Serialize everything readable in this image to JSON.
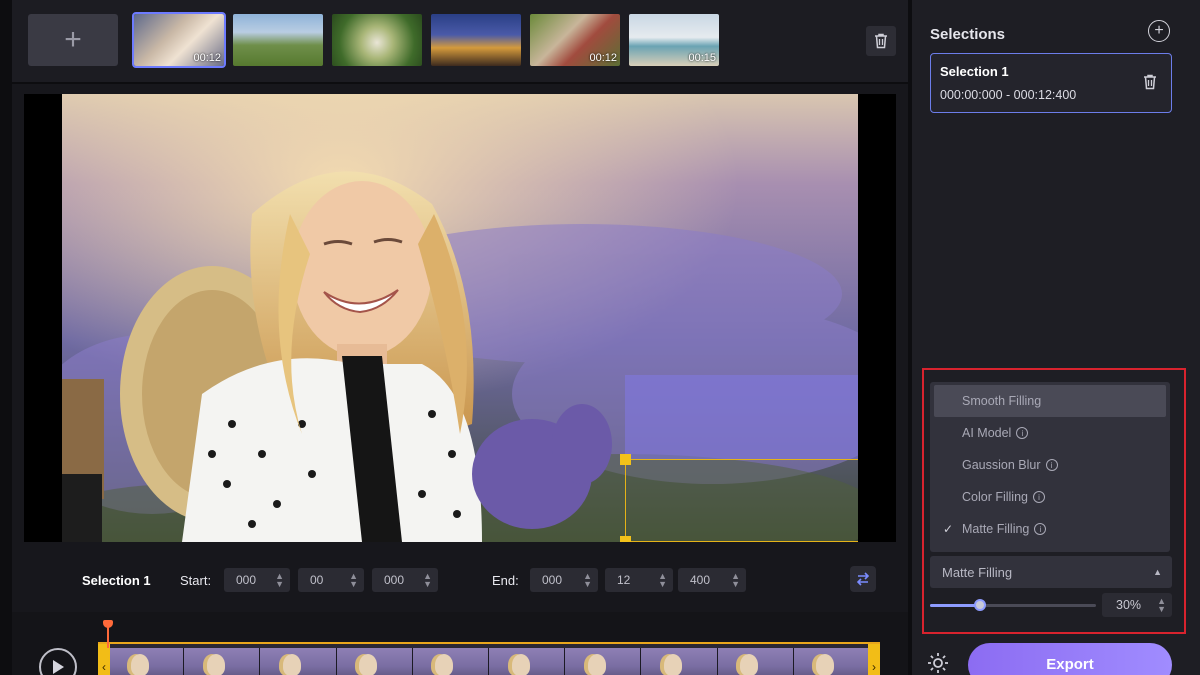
{
  "topbar": {
    "add_label": "+",
    "thumbnails": [
      {
        "duration": "00:12",
        "active": true
      },
      {
        "duration": "",
        "active": false
      },
      {
        "duration": "",
        "active": false
      },
      {
        "duration": "",
        "active": false
      },
      {
        "duration": "00:12",
        "active": false
      },
      {
        "duration": "00:15",
        "active": false
      }
    ]
  },
  "timebar": {
    "selection_name": "Selection 1",
    "start_label": "Start:",
    "end_label": "End:",
    "start": [
      "000",
      "00",
      "000"
    ],
    "end": [
      "000",
      "12",
      "400"
    ]
  },
  "sidebar": {
    "title": "Selections",
    "selection": {
      "name": "Selection 1",
      "range": "000:00:000 - 000:12:400"
    },
    "menu": [
      {
        "label": "Smooth Filling",
        "info": false,
        "highlighted": true,
        "checked": false
      },
      {
        "label": "AI Model",
        "info": true,
        "highlighted": false,
        "checked": false
      },
      {
        "label": "Gaussion Blur",
        "info": true,
        "highlighted": false,
        "checked": false
      },
      {
        "label": "Color Filling",
        "info": true,
        "highlighted": false,
        "checked": false
      },
      {
        "label": "Matte Filling",
        "info": true,
        "highlighted": false,
        "checked": true
      }
    ],
    "dropdown_value": "Matte Filling",
    "opacity_percent": 30,
    "opacity_label": "30%",
    "export_label": "Export"
  },
  "colors": {
    "accent": "#8c6cf2",
    "selection_border": "#6c7dea",
    "highlight_frame": "#d8232e",
    "handle": "#f3c21a"
  }
}
